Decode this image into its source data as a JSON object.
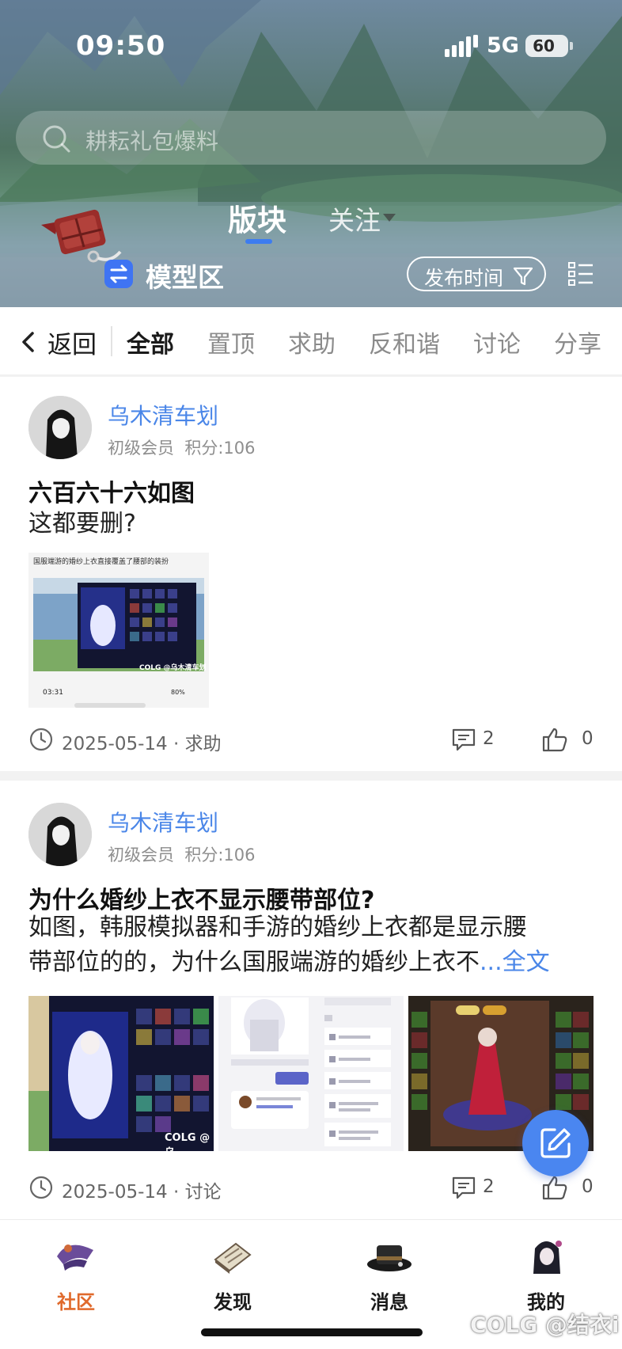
{
  "status_bar": {
    "time": "09:50",
    "network": "5G",
    "battery": "60"
  },
  "search": {
    "placeholder": "耕耘礼包爆料"
  },
  "top_tabs": {
    "section": "版块",
    "follow": "关注"
  },
  "board": {
    "name": "模型区",
    "sort_label": "发布时间"
  },
  "categories": {
    "back": "返回",
    "items": [
      "全部",
      "置顶",
      "求助",
      "反和谐",
      "讨论",
      "分享"
    ],
    "active": "全部"
  },
  "posts": [
    {
      "author": "乌木清车划",
      "rank": "初级会员",
      "points": "积分:106",
      "title": "六百六十六如图",
      "body": "这都要删?",
      "image_caption": "国服端游的婚纱上衣直接覆盖了腰部的装扮",
      "image_watermark": "COLG @乌木清车划",
      "image_time": "03:31",
      "image_battery": "80%",
      "date": "2025-05-14",
      "tag": "求助",
      "comments": "2",
      "likes": "0"
    },
    {
      "author": "乌木清车划",
      "rank": "初级会员",
      "points": "积分:106",
      "title": "为什么婚纱上衣不显示腰带部位?",
      "body_line1": "如图，韩服模拟器和手游的婚纱上衣都是显示腰",
      "body_line2": "带部位的的，为什么国服端游的婚纱上衣不",
      "more": "...全文",
      "image_watermark": "COLG @乌",
      "date": "2025-05-14",
      "tag": "讨论",
      "comments": "2",
      "likes": "0"
    }
  ],
  "bottom_nav": [
    {
      "label": "社区",
      "active": true,
      "icon": "community-icon"
    },
    {
      "label": "发现",
      "active": false,
      "icon": "discover-icon"
    },
    {
      "label": "消息",
      "active": false,
      "icon": "message-icon"
    },
    {
      "label": "我的",
      "active": false,
      "icon": "profile-icon"
    }
  ],
  "watermark": "COLG @结衣i",
  "colors": {
    "accent": "#4a86e8",
    "active_nav": "#e06a2c",
    "fab": "#4a86f0",
    "board_icon": "#3f74f3"
  }
}
